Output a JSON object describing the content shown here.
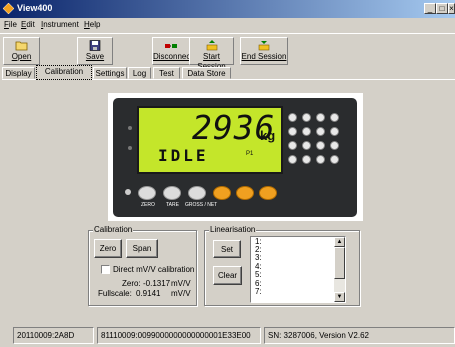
{
  "window": {
    "title": "View400",
    "minimize": "_",
    "maximize": "□",
    "close": "×"
  },
  "menu": [
    {
      "label": "File",
      "accel": "F",
      "rest": "ile"
    },
    {
      "label": "Edit",
      "accel": "E",
      "rest": "dit"
    },
    {
      "label": "Instrument",
      "accel": "I",
      "rest": "nstrument"
    },
    {
      "label": "Help",
      "accel": "H",
      "rest": "elp"
    }
  ],
  "toolbar": {
    "open": "Open",
    "save": "Save",
    "disconnect": "Disconnect",
    "start_session": "Start Session",
    "end_session": "End Session"
  },
  "tabs": [
    "Display",
    "Calibration",
    "Settings",
    "Log",
    "Test",
    "Data Store"
  ],
  "active_tab": "Calibration",
  "indicator": {
    "weight": "2936",
    "unit": "kg",
    "status": "IDLE",
    "annunciator": "P1",
    "key_labels": [
      "ZERO",
      "TARE",
      "GROSS / NET"
    ]
  },
  "calibration": {
    "title": "Calibration",
    "zero_button": "Zero",
    "span_button": "Span",
    "direct_label": "Direct mV/V calibration",
    "zero_label": "Zero:",
    "zero_value": "-0.1317",
    "zero_unit": "mV/V",
    "fullscale_label": "Fullscale:",
    "fullscale_value": "0.9141",
    "fullscale_unit": "mV/V"
  },
  "linearisation": {
    "title": "Linearisation",
    "set_button": "Set",
    "clear_button": "Clear",
    "points": [
      "1:",
      "2:",
      "3:",
      "4:",
      "5:",
      "6:",
      "7:"
    ]
  },
  "statusbar": [
    "20110009:2A8D",
    "81110009:0099000000000000001E33E00",
    "SN: 3287006, Version V2.62"
  ]
}
